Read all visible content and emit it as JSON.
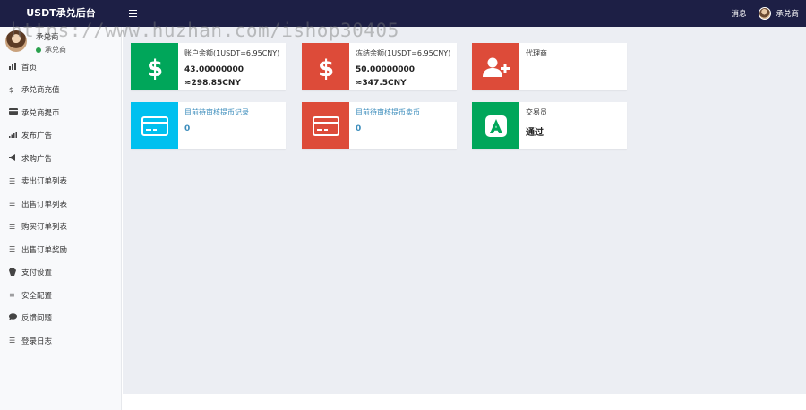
{
  "header": {
    "brand": "USDT承兑后台",
    "messages": "消息",
    "user": "承兑商"
  },
  "sidebar": {
    "user_name": "承兑商",
    "user_status": "承兑商",
    "items": [
      {
        "icon": "bar-chart-icon",
        "glyph": "📶",
        "label": "首页"
      },
      {
        "icon": "dollar-icon",
        "glyph": "$",
        "label": "承兑商充值"
      },
      {
        "icon": "credit-card-icon",
        "glyph": "▬",
        "label": "承兑商提币"
      },
      {
        "icon": "signal-icon",
        "glyph": "ıl",
        "label": "发布广告"
      },
      {
        "icon": "bullhorn-icon",
        "glyph": "◀",
        "label": "求购广告"
      },
      {
        "icon": "list-icon",
        "glyph": "☰",
        "label": "卖出订单列表"
      },
      {
        "icon": "list-icon",
        "glyph": "☰",
        "label": "出售订单列表"
      },
      {
        "icon": "list-icon",
        "glyph": "☰",
        "label": "购买订单列表"
      },
      {
        "icon": "list-icon",
        "glyph": "☰",
        "label": "出售订单奖励"
      },
      {
        "icon": "cog-icon",
        "glyph": "⚙",
        "label": "支付设置"
      },
      {
        "icon": "bars-icon",
        "glyph": "≡",
        "label": "安全配置"
      },
      {
        "icon": "comment-icon",
        "glyph": "●",
        "label": "反馈问题"
      },
      {
        "icon": "list-ol-icon",
        "glyph": "☰",
        "label": "登录日志"
      }
    ]
  },
  "cards": [
    {
      "label": "账户余额(1USDT=6.95CNY)",
      "value1": "43.00000000",
      "value2": "≈298.85CNY",
      "color": "#00a65a",
      "icon": "dollar-icon"
    },
    {
      "label": "冻结余额(1USDT=6.95CNY)",
      "value1": "50.00000000",
      "value2": "≈347.5CNY",
      "color": "#dd4b39",
      "icon": "dollar-icon"
    },
    {
      "label": "代理商",
      "color": "#dd4b39",
      "icon": "user-plus-icon"
    },
    {
      "label": "目前待审核提币记录",
      "value": "0",
      "color": "#00c0ef",
      "icon": "credit-card-icon"
    },
    {
      "label": "目前待审核提币卖币",
      "value": "0",
      "color": "#dd4b39",
      "icon": "credit-card-icon"
    },
    {
      "label": "交易员",
      "value": "通过",
      "color": "#00a65a",
      "icon": "app-a-icon"
    }
  ],
  "watermark": "https://www.huzhan.com/ishop30405"
}
